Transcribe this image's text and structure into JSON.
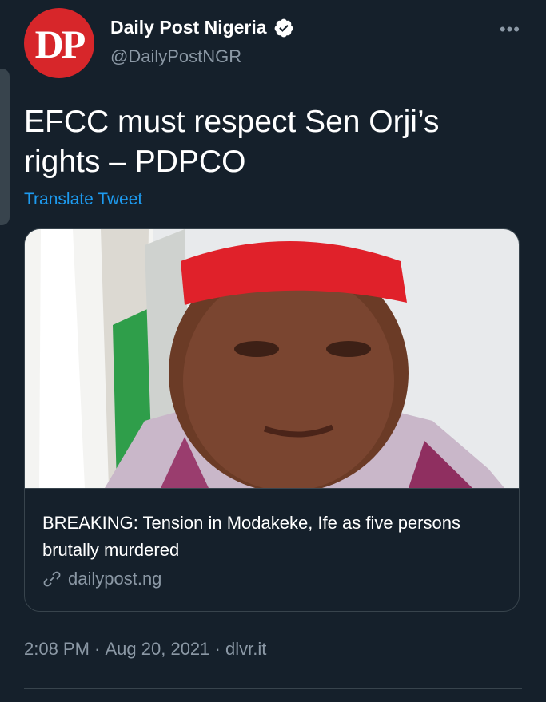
{
  "tweet": {
    "avatar_text": "DP",
    "display_name": "Daily Post Nigeria",
    "handle": "@DailyPostNGR",
    "more_label": "•••",
    "text": "EFCC must respect Sen Orji’s rights – PDPCO",
    "translate_label": "Translate Tweet",
    "card": {
      "title": "BREAKING: Tension in Modakeke, Ife as five persons brutally murdered",
      "domain": "dailypost.ng"
    },
    "time": "2:08 PM",
    "date": "Aug 20, 2021",
    "source": "dlvr.it",
    "separator": " · "
  },
  "icons": {
    "verified": "verified-badge-icon",
    "more": "more-options-icon",
    "link": "link-icon"
  },
  "colors": {
    "background": "#15202b",
    "accent_link": "#1d9bf0",
    "secondary_text": "#8b98a5",
    "border": "#38444d",
    "avatar_red": "#d7262a"
  }
}
